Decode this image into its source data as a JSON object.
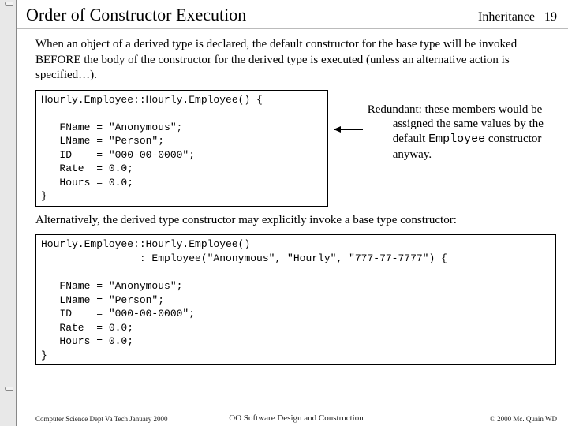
{
  "header": {
    "title": "Order of Constructor Execution",
    "topic": "Inheritance",
    "page": "19"
  },
  "para1": "When an object of a derived type is declared, the default constructor for the base type will be invoked BEFORE the body of the constructor for the derived type is executed (unless an alternative action is specified…).",
  "code1": "Hourly.Employee::Hourly.Employee() {\n\n   FName = \"Anonymous\";\n   LName = \"Person\";\n   ID    = \"000-00-0000\";\n   Rate  = 0.0;\n   Hours = 0.0;\n}",
  "side_note_prefix": "Redundant:  these members would be assigned the same values by the default ",
  "side_note_mono": "Employee",
  "side_note_suffix": " constructor anyway.",
  "para2": "Alternatively, the derived type constructor may explicitly invoke a base type constructor:",
  "code2": "Hourly.Employee::Hourly.Employee()\n                : Employee(\"Anonymous\", \"Hourly\", \"777-77-7777\") {\n\n   FName = \"Anonymous\";\n   LName = \"Person\";\n   ID    = \"000-00-0000\";\n   Rate  = 0.0;\n   Hours = 0.0;\n}",
  "footer": {
    "left": "Computer Science Dept Va Tech January 2000",
    "center": "OO Software Design and Construction",
    "right": "© 2000  Mc. Quain WD"
  }
}
